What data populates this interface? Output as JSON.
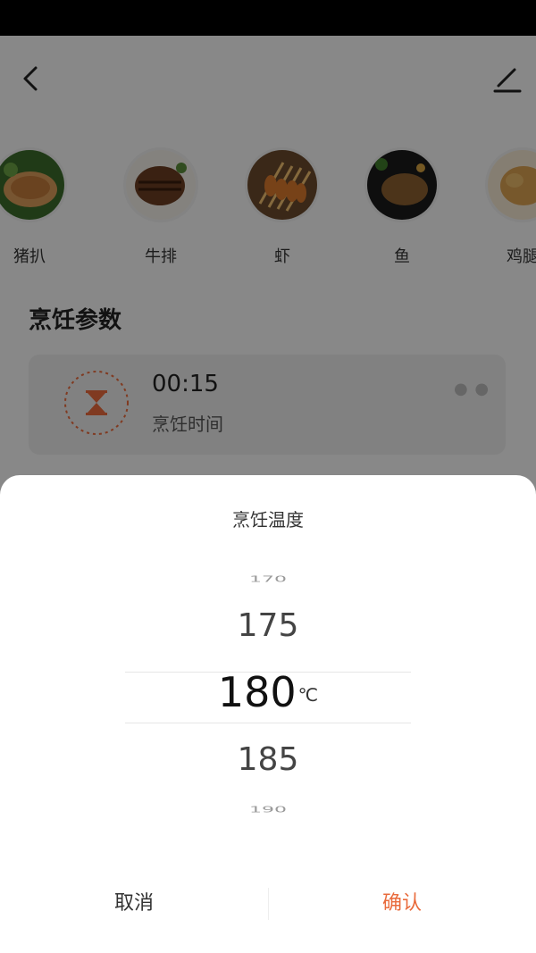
{
  "header": {
    "back_icon": "chevron-left-icon",
    "edit_icon": "pencil-icon"
  },
  "foods": [
    {
      "label": "猪扒",
      "icon": "pork-chop-photo"
    },
    {
      "label": "牛排",
      "icon": "steak-photo"
    },
    {
      "label": "虾",
      "icon": "shrimp-skewers-photo"
    },
    {
      "label": "鱼",
      "icon": "fish-photo"
    },
    {
      "label": "鸡腿",
      "icon": "chicken-leg-photo"
    }
  ],
  "section": {
    "title": "烹饪参数"
  },
  "param_card": {
    "time_value": "00:15",
    "time_label": "烹饪时间",
    "icon": "hourglass-icon",
    "more_icon": "more-dots-icon",
    "accent": "#e96b3c"
  },
  "dialog": {
    "title": "烹饪温度",
    "picker": {
      "far_top": "170",
      "near_top": "175",
      "selected": "180",
      "unit": "℃",
      "near_bottom": "185",
      "far_bottom": "190"
    },
    "cancel_label": "取消",
    "confirm_label": "确认",
    "confirm_color": "#e96b3c"
  }
}
